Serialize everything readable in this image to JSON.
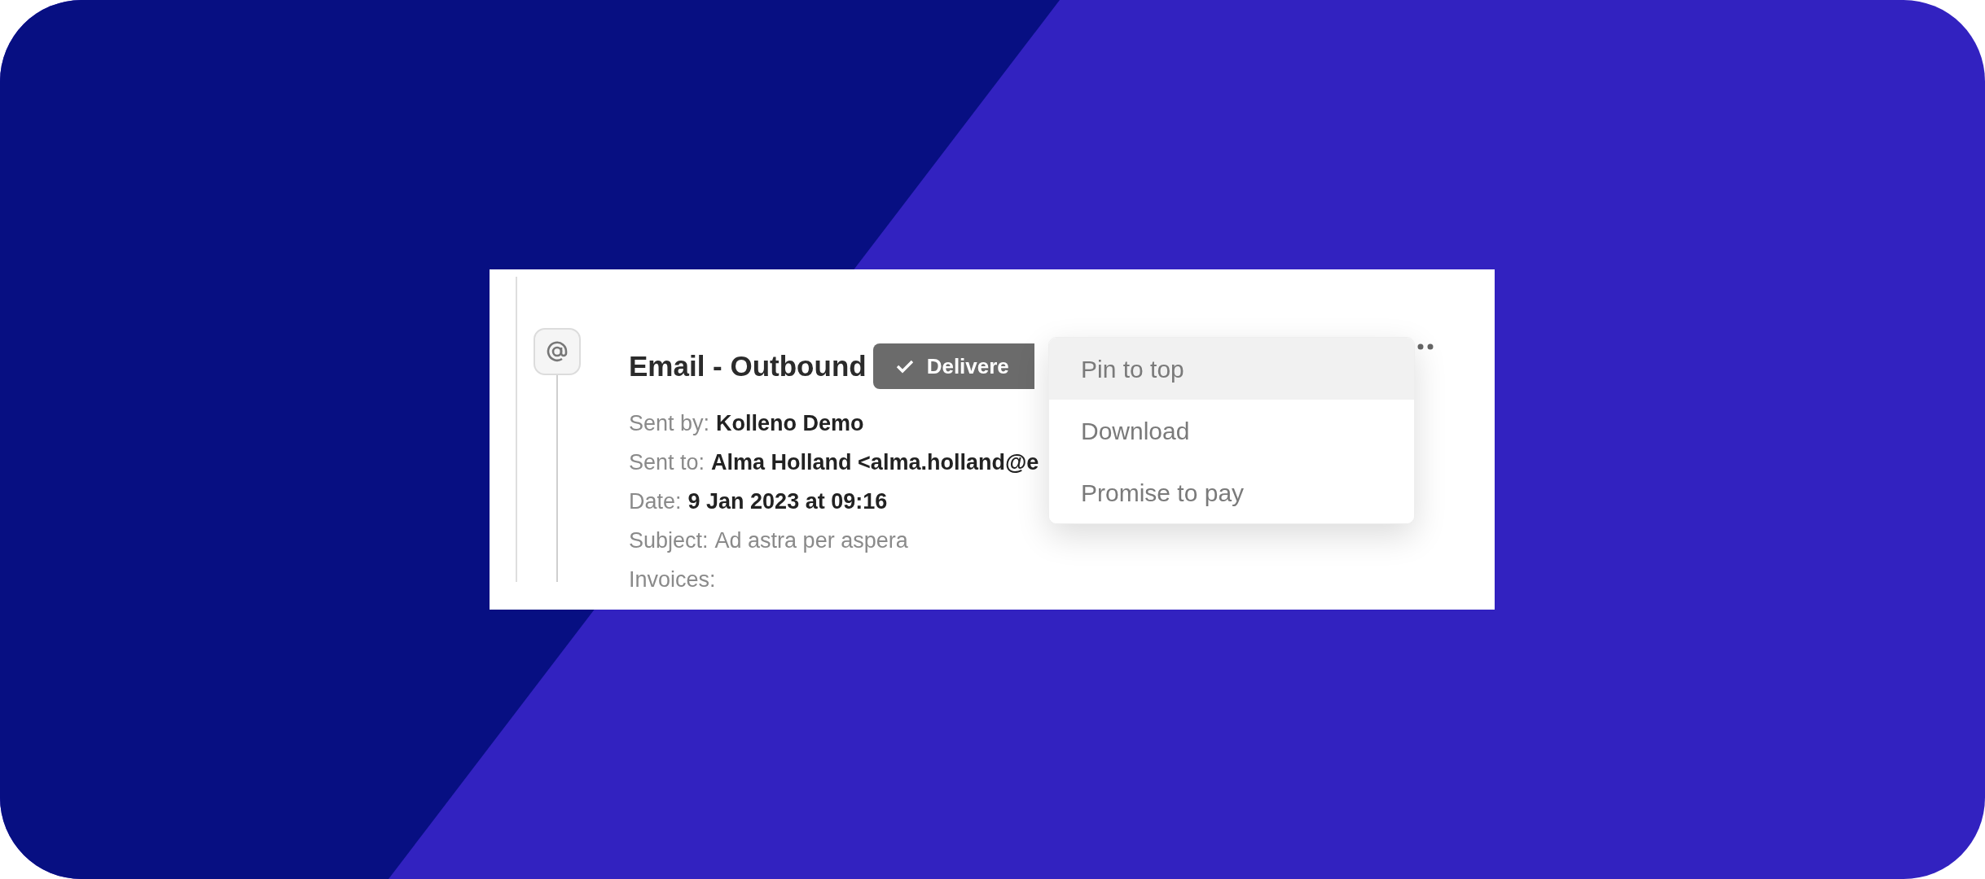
{
  "entry": {
    "title": "Email - Outbound",
    "badge": {
      "label": "Delivere"
    },
    "fields": [
      {
        "label": "Sent by:",
        "value": "Kolleno Demo",
        "bold": true
      },
      {
        "label": "Sent to:",
        "value": "Alma Holland <alma.holland@e",
        "bold": true
      },
      {
        "label": "Date:",
        "value": "9 Jan 2023 at 09:16",
        "bold": true
      },
      {
        "label": "Subject:",
        "value": "Ad astra per aspera",
        "bold": false
      },
      {
        "label": "Invoices:"
      }
    ]
  },
  "menu": {
    "items": [
      {
        "label": "Pin to top",
        "selected": true
      },
      {
        "label": "Download",
        "selected": false
      },
      {
        "label": "Promise to pay",
        "selected": false
      }
    ]
  }
}
